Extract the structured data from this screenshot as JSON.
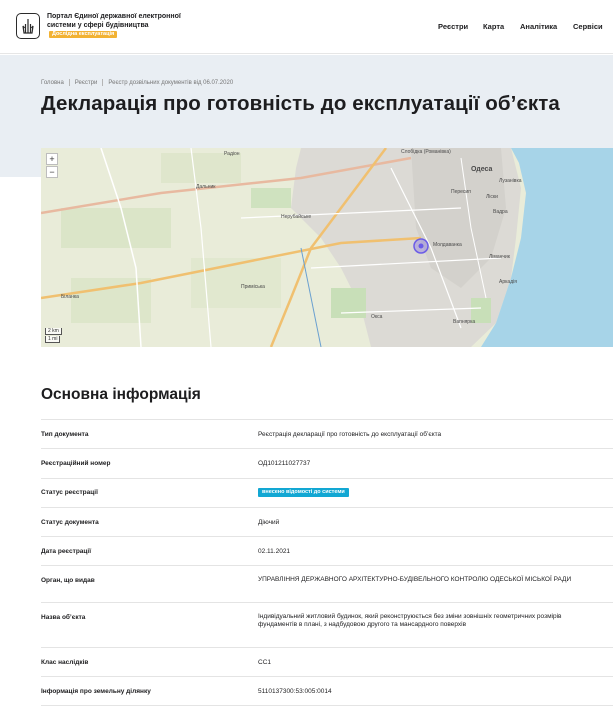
{
  "header": {
    "portal_name": "Портал Єдиної державної електронної системи у сфері будівництва",
    "beta_label": "Дослідна експлуатація",
    "nav": [
      "Реєстри",
      "Карта",
      "Аналітика",
      "Сервіси"
    ]
  },
  "breadcrumb": [
    "Головна",
    "Реєстри",
    "Реєстр дозвільних документів від 06.07.2020"
  ],
  "page_title": "Декларація про готовність до експлуатації об’єкта",
  "map": {
    "zoom_in": "+",
    "zoom_out": "−",
    "scale_km": "2 km",
    "scale_mi": "1 mi",
    "place_labels": [
      "Одеса",
      "Слобідка (Романівка)",
      "Лузанівка",
      "Пересип",
      "Ліски",
      "Вадра",
      "Молдаванка",
      "Ліманчик",
      "Аркадія",
      "Приміська",
      "Біланка",
      "Нерубайське",
      "Вапнярка",
      "Радіон",
      "Дальник",
      "Окса"
    ]
  },
  "section_title": "Основна інформація",
  "rows": [
    {
      "label": "Тип документа",
      "value": "Реєстрація декларації про готовність до експлуатації об’єкта"
    },
    {
      "label": "Реєстраційний номер",
      "value": "ОД101211027737"
    },
    {
      "label": "Статус реєстрації",
      "value": "внесено відомості до системи"
    },
    {
      "label": "Статус документа",
      "value": "Діючий"
    },
    {
      "label": "Дата реєстрації",
      "value": "02.11.2021"
    },
    {
      "label": "Орган, що видав",
      "value": "УПРАВЛІННЯ ДЕРЖАВНОГО АРХІТЕКТУРНО-БУДІВЕЛЬНОГО КОНТРОЛЮ ОДЕСЬКОЇ МІСЬКОЇ РАДИ"
    },
    {
      "label": "Назва об’єкта",
      "value": "Індивідуальний житловий будинок, який реконструюється без зміни зовнішніх геометричних розмірів фундаментів в плані, з надбудовою другого та мансардного поверхів"
    },
    {
      "label": "Клас наслідків",
      "value": "СС1"
    },
    {
      "label": "Інформація про земельну ділянку",
      "value": "5110137300:53:005:0014"
    }
  ],
  "colors": {
    "accent_beta": "#f2b233",
    "status_badge": "#12a7d3",
    "hero_bg": "#e9eef3",
    "sea": "#a7d4e8"
  }
}
